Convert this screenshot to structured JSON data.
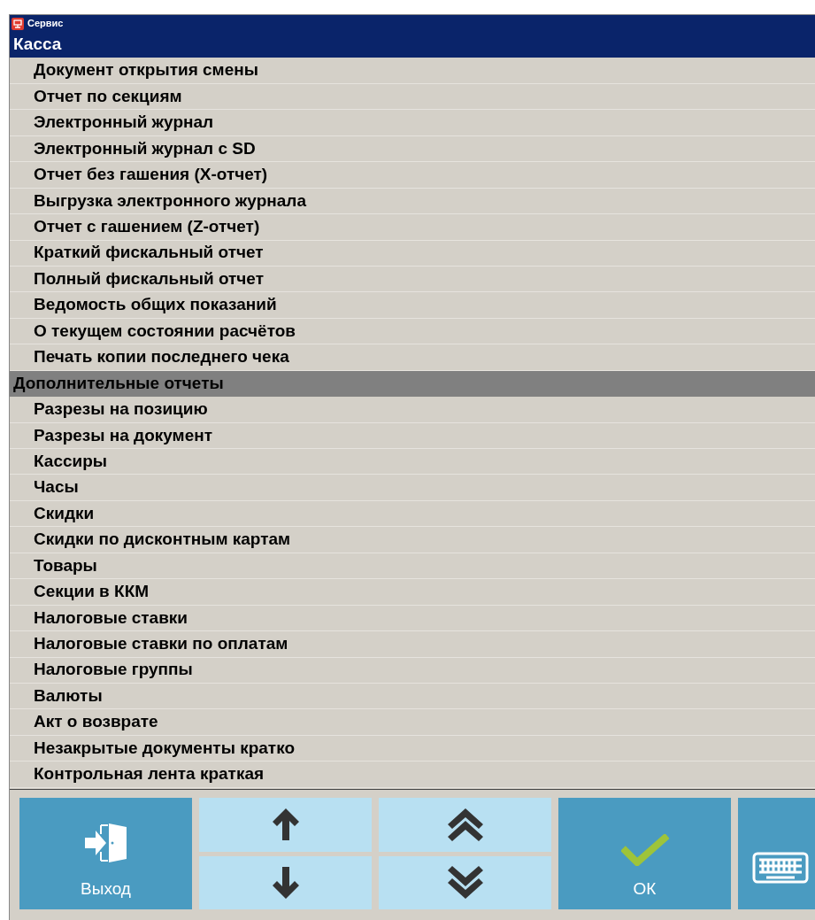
{
  "window": {
    "title": "Сервис"
  },
  "groups": [
    {
      "title": "Касса",
      "selected": true,
      "items": [
        "Документ открытия смены",
        "Отчет по секциям",
        "Электронный журнал",
        "Электронный журнал с SD",
        "Отчет без гашения (X-отчет)",
        "Выгрузка электронного журнала",
        "Отчет с гашением (Z-отчет)",
        "Краткий фискальный отчет",
        "Полный фискальный отчет",
        "Ведомость общих показаний",
        "О текущем состоянии расчётов",
        "Печать копии последнего чека"
      ]
    },
    {
      "title": "Дополнительные отчеты",
      "selected": false,
      "items": [
        "Разрезы на позицию",
        "Разрезы на документ",
        "Кассиры",
        "Часы",
        "Скидки",
        "Скидки по дисконтным картам",
        "Товары",
        "Секции в ККМ",
        "Налоговые ставки",
        "Налоговые ставки по оплатам",
        "Налоговые группы",
        "Валюты",
        "Акт о возврате",
        "Незакрытые документы кратко",
        "Контрольная лента краткая"
      ]
    }
  ],
  "buttons": [
    {
      "kind": "exit",
      "label": "Выход"
    },
    {
      "kind": "updown"
    },
    {
      "kind": "pageupdown"
    },
    {
      "kind": "ok",
      "label": "ОК"
    },
    {
      "kind": "keyboard"
    }
  ]
}
